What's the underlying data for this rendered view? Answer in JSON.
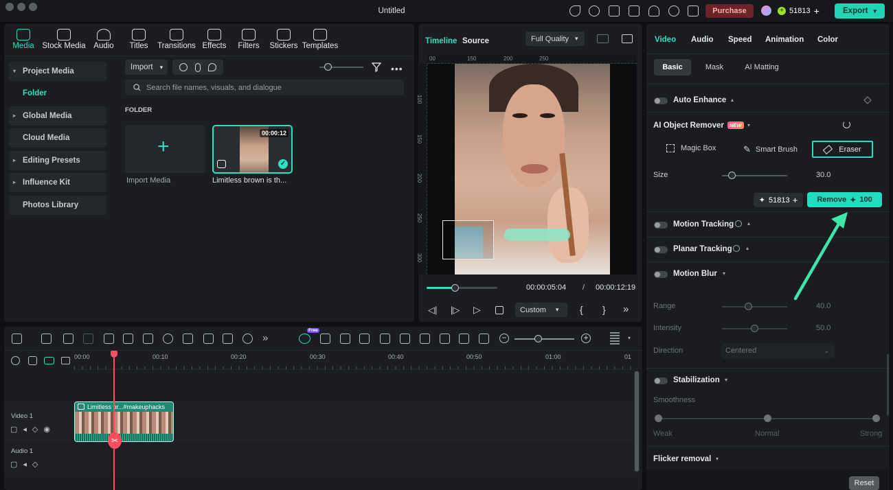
{
  "window": {
    "title": "Untitled",
    "purchase_label": "Purchase",
    "credits": "51813",
    "export_label": "Export"
  },
  "media_tabs": [
    "Media",
    "Stock Media",
    "Audio",
    "Titles",
    "Transitions",
    "Effects",
    "Filters",
    "Stickers",
    "Templates"
  ],
  "sidebar": {
    "items": [
      {
        "label": "Project Media",
        "caret": "▾"
      },
      {
        "label": "Folder"
      },
      {
        "label": "Global Media",
        "caret": "▸"
      },
      {
        "label": "Cloud Media"
      },
      {
        "label": "Editing Presets",
        "caret": "▸"
      },
      {
        "label": "Influence Kit",
        "caret": "▸"
      },
      {
        "label": "Photos Library"
      }
    ]
  },
  "library": {
    "import_label": "Import",
    "search_placeholder": "Search file names, visuals, and dialogue",
    "folder_heading": "FOLDER",
    "import_media_label": "Import Media",
    "clip_name": "Limitless brown is th...",
    "clip_duration": "00:00:12"
  },
  "preview": {
    "tab_timeline": "Timeline",
    "tab_source": "Source",
    "quality": "Full Quality",
    "ruler_h": [
      "00",
      "150",
      "200",
      "250"
    ],
    "ruler_v": [
      "100",
      "150",
      "200",
      "250",
      "300"
    ],
    "current_time": "00:00:05:04",
    "separator": "/",
    "total_time": "00:00:12:19",
    "playback_progress": 0.4,
    "zoom_label": "Custom"
  },
  "inspector": {
    "tabs": [
      "Video",
      "Audio",
      "Speed",
      "Animation",
      "Color"
    ],
    "subtabs": [
      "Basic",
      "Mask",
      "AI Matting"
    ],
    "auto_enhance": "Auto Enhance",
    "ai_object_remover": "AI Object Remover",
    "new_badge": "NEW",
    "tools": [
      "Magic Box",
      "Smart Brush",
      "Eraser"
    ],
    "size_label": "Size",
    "size_value": "30.0",
    "size_fraction": 0.15,
    "credits": "51813",
    "remove_label": "Remove",
    "remove_cost": "100",
    "motion_tracking": "Motion Tracking",
    "planar_tracking": "Planar Tracking",
    "motion_blur": "Motion Blur",
    "range_label": "Range",
    "range_value": "40.0",
    "intensity_label": "Intensity",
    "intensity_value": "50.0",
    "direction_label": "Direction",
    "direction_value": "Centered",
    "stabilization": "Stabilization",
    "smoothness_label": "Smoothness",
    "smooth_weak": "Weak",
    "smooth_normal": "Normal",
    "smooth_strong": "Strong",
    "flicker_removal": "Flicker removal",
    "reset_label": "Reset"
  },
  "timeline": {
    "ruler": [
      "00:00",
      "00:10",
      "00:20",
      "00:30",
      "00:40",
      "00:50",
      "01:00",
      "01"
    ],
    "video_track": "Video 1",
    "audio_track": "Audio 1",
    "clip_label": "Limitless br...#makeuphacks",
    "free_badge": "Free"
  },
  "colors": {
    "accent": "#2fe0c0",
    "purchase": "#7a2a2e",
    "arrow": "#3ee6a8",
    "eraser_highlight": "#25e0c0"
  }
}
